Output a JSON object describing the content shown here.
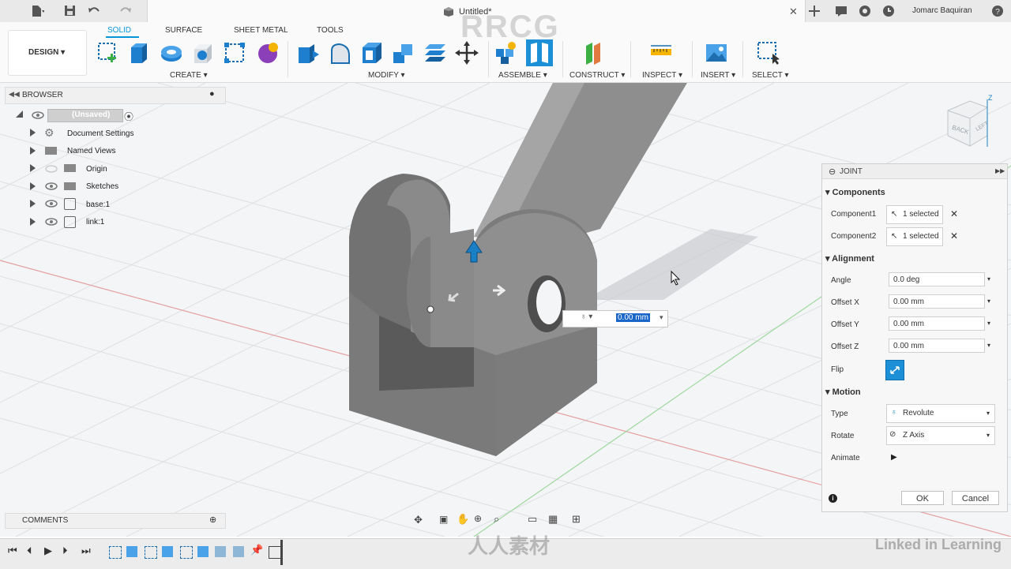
{
  "tab": {
    "title": "Untitled*"
  },
  "user": {
    "name": "Jomarc Baquiran"
  },
  "workspace": {
    "label": "DESIGN"
  },
  "ribbon_tabs": [
    "SOLID",
    "SURFACE",
    "SHEET METAL",
    "TOOLS"
  ],
  "ribbon_groups": [
    "CREATE",
    "MODIFY",
    "ASSEMBLE",
    "CONSTRUCT",
    "INSPECT",
    "INSERT",
    "SELECT"
  ],
  "browser": {
    "title": "BROWSER",
    "root": "(Unsaved)",
    "items": [
      "Document Settings",
      "Named Views",
      "Origin",
      "Sketches",
      "base:1",
      "link:1"
    ]
  },
  "comments": {
    "title": "COMMENTS"
  },
  "joint": {
    "title": "JOINT",
    "sections": {
      "components": "Components",
      "alignment": "Alignment",
      "motion": "Motion"
    },
    "component1_label": "Component1",
    "component1_value": "1 selected",
    "component2_label": "Component2",
    "component2_value": "1 selected",
    "angle_label": "Angle",
    "angle_value": "0.0 deg",
    "offset_x_label": "Offset X",
    "offset_x_value": "0.00 mm",
    "offset_y_label": "Offset Y",
    "offset_y_value": "0.00 mm",
    "offset_z_label": "Offset Z",
    "offset_z_value": "0.00 mm",
    "flip_label": "Flip",
    "type_label": "Type",
    "type_value": "Revolute",
    "rotate_label": "Rotate",
    "rotate_value": "Z Axis",
    "animate_label": "Animate",
    "ok": "OK",
    "cancel": "Cancel"
  },
  "viewport_input": {
    "value": "0.00 mm"
  },
  "viewcube": {
    "face": "BACK",
    "side": "LEFT",
    "axis": "Z"
  },
  "watermarks": {
    "top": "RRCG",
    "bottom": "人人素材",
    "brand": "Linked in Learning"
  },
  "colors": {
    "accent": "#0696d7",
    "flip_button": "#1d8fd6"
  }
}
